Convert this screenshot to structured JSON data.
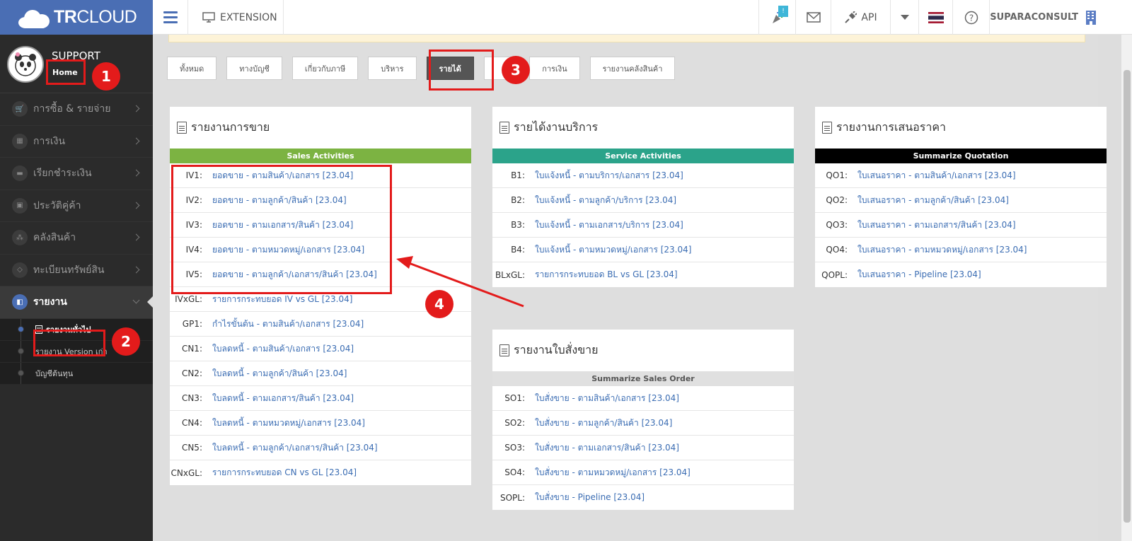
{
  "app": {
    "logo_bold": "TR",
    "logo_rest": "CLOUD",
    "extension_label": "EXTENSION",
    "api_label": "API",
    "notify_count": "!",
    "user_name": "SUPARACONSULT"
  },
  "profile": {
    "name": "SUPPORT",
    "home_label": "Home",
    "sep": "|"
  },
  "sidebar": {
    "items": [
      {
        "label": "การซื้อ & รายจ่าย",
        "icon": "cart-icon"
      },
      {
        "label": "การเงิน",
        "icon": "calendar-icon"
      },
      {
        "label": "เรียกชำระเงิน",
        "icon": "card-icon"
      },
      {
        "label": "ประวัติคู่ค้า",
        "icon": "contact-icon"
      },
      {
        "label": "คลังสินค้า",
        "icon": "boxes-icon"
      },
      {
        "label": "ทะเบียนทรัพย์สิน",
        "icon": "diamond-icon"
      },
      {
        "label": "รายงาน",
        "icon": "report-icon"
      }
    ],
    "submenu": [
      {
        "label": "รายงานทั่วไป"
      },
      {
        "label": "รายงาน Version เก่า"
      },
      {
        "label": "บัญชีต้นทุน"
      }
    ]
  },
  "tabs": [
    "ทั้งหมด",
    "ทางบัญชี",
    "เกี่ยวกับภาษี",
    "บริหาร",
    "รายได้",
    "ย",
    "การเงิน",
    "รายงานคลังสินค้า"
  ],
  "panels": {
    "sales": {
      "title": "รายงานการขาย",
      "section": "Sales Activities",
      "section_color": "#7cb342",
      "rows": [
        {
          "code": "IV1:",
          "text": "ยอดขาย - ตามสินค้า/เอกสาร [23.04]"
        },
        {
          "code": "IV2:",
          "text": "ยอดขาย - ตามลูกค้า/สินค้า [23.04]"
        },
        {
          "code": "IV3:",
          "text": "ยอดขาย - ตามเอกสาร/สินค้า [23.04]"
        },
        {
          "code": "IV4:",
          "text": "ยอดขาย - ตามหมวดหมู่/เอกสาร [23.04]"
        },
        {
          "code": "IV5:",
          "text": "ยอดขาย - ตามลูกค้า/เอกสาร/สินค้า [23.04]"
        },
        {
          "code": "IVxGL:",
          "text": "รายการกระทบยอด IV vs GL [23.04]"
        },
        {
          "code": "GP1:",
          "text": "กำไรขั้นต้น - ตามสินค้า/เอกสาร [23.04]"
        },
        {
          "code": "CN1:",
          "text": "ใบลดหนี้ - ตามสินค้า/เอกสาร [23.04]"
        },
        {
          "code": "CN2:",
          "text": "ใบลดหนี้ - ตามลูกค้า/สินค้า [23.04]"
        },
        {
          "code": "CN3:",
          "text": "ใบลดหนี้ - ตามเอกสาร/สินค้า [23.04]"
        },
        {
          "code": "CN4:",
          "text": "ใบลดหนี้ - ตามหมวดหมู่/เอกสาร [23.04]"
        },
        {
          "code": "CN5:",
          "text": "ใบลดหนี้ - ตามลูกค้า/เอกสาร/สินค้า [23.04]"
        },
        {
          "code": "CNxGL:",
          "text": "รายการกระทบยอด CN vs GL [23.04]"
        }
      ]
    },
    "service": {
      "title": "รายได้งานบริการ",
      "section": "Service Activities",
      "section_color": "#2ba38a",
      "rows": [
        {
          "code": "B1:",
          "text": "ใบแจ้งหนี้ - ตามบริการ/เอกสาร [23.04]"
        },
        {
          "code": "B2:",
          "text": "ใบแจ้งหนี้ - ตามลูกค้า/บริการ [23.04]"
        },
        {
          "code": "B3:",
          "text": "ใบแจ้งหนี้ - ตามเอกสาร/บริการ [23.04]"
        },
        {
          "code": "B4:",
          "text": "ใบแจ้งหนี้ - ตามหมวดหมู่/เอกสาร [23.04]"
        },
        {
          "code": "BLxGL:",
          "text": "รายการกระทบยอด BL vs GL [23.04]"
        }
      ]
    },
    "quotation": {
      "title": "รายงานการเสนอราคา",
      "section": "Summarize Quotation",
      "section_color": "#000000",
      "rows": [
        {
          "code": "QO1:",
          "text": "ใบเสนอราคา - ตามสินค้า/เอกสาร [23.04]"
        },
        {
          "code": "QO2:",
          "text": "ใบเสนอราคา - ตามลูกค้า/สินค้า [23.04]"
        },
        {
          "code": "QO3:",
          "text": "ใบเสนอราคา - ตามเอกสาร/สินค้า [23.04]"
        },
        {
          "code": "QO4:",
          "text": "ใบเสนอราคา - ตามหมวดหมู่/เอกสาร [23.04]"
        },
        {
          "code": "QOPL:",
          "text": "ใบเสนอราคา - Pipeline [23.04]"
        }
      ]
    },
    "salesorder": {
      "title": "รายงานใบสั่งขาย",
      "section": "Summarize Sales Order",
      "section_color": "#e0e0e0",
      "rows": [
        {
          "code": "SO1:",
          "text": "ใบสั่งขาย - ตามสินค้า/เอกสาร [23.04]"
        },
        {
          "code": "SO2:",
          "text": "ใบสั่งขาย - ตามลูกค้า/สินค้า [23.04]"
        },
        {
          "code": "SO3:",
          "text": "ใบสั่งขาย - ตามเอกสาร/สินค้า [23.04]"
        },
        {
          "code": "SO4:",
          "text": "ใบสั่งขาย - ตามหมวดหมู่/เอกสาร [23.04]"
        },
        {
          "code": "SOPL:",
          "text": "ใบสั่งขาย - Pipeline [23.04]"
        }
      ]
    }
  },
  "annotations": [
    "1",
    "2",
    "3",
    "4"
  ],
  "colors": {
    "brand": "#4a6eb4",
    "annotation": "#e31b1b",
    "link": "#3b6db3"
  }
}
